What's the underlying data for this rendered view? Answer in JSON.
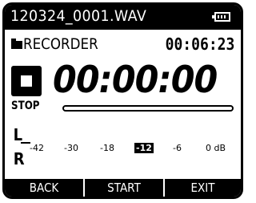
{
  "header": {
    "filename": "120324_0001.WAV",
    "battery_icon": "battery-icon"
  },
  "mode": {
    "folder_icon": "folder-icon",
    "label": "RECORDER",
    "total_time": "00:06:23"
  },
  "status": {
    "icon": "stop-icon",
    "label": "STOP",
    "elapsed_time": "00:00:00",
    "progress": 0
  },
  "level_meter": {
    "left_channel": "L",
    "right_channel": "R",
    "scale": [
      "-42",
      "-30",
      "-18",
      "-12",
      "-6",
      "0 dB"
    ],
    "peak_marker": "-12"
  },
  "softkeys": {
    "back": "BACK",
    "start": "START",
    "exit": "EXIT"
  }
}
